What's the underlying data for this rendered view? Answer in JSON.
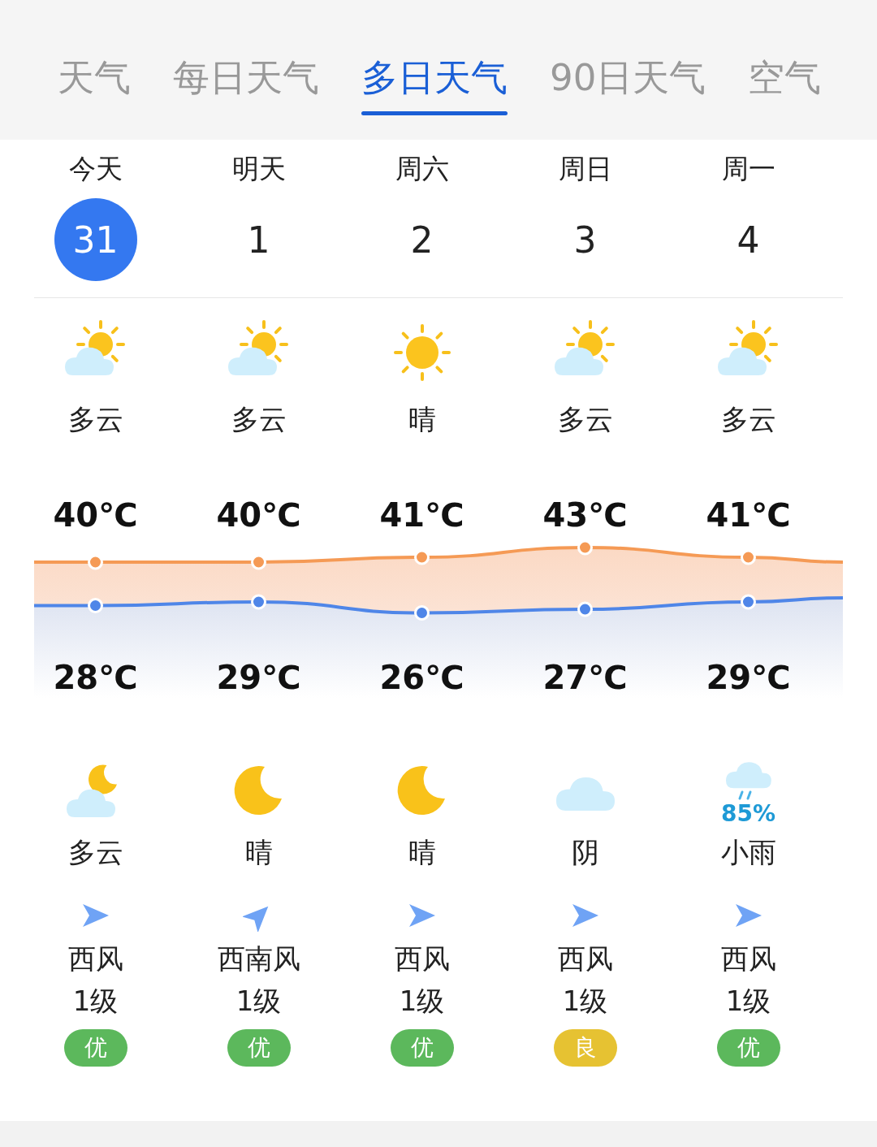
{
  "tabs": [
    {
      "label": "天气",
      "selected": false
    },
    {
      "label": "每日天气",
      "selected": false
    },
    {
      "label": "多日天气",
      "selected": true
    },
    {
      "label": "90日天气",
      "selected": false
    },
    {
      "label": "空气",
      "selected": false
    }
  ],
  "days": [
    {
      "label": "今天",
      "date": "31",
      "selected": true,
      "day": {
        "kind": "partly-cloudy",
        "weather": "多云"
      },
      "high": "40℃",
      "low": "28℃",
      "night": {
        "kind": "moon-cloud",
        "weather": "多云"
      },
      "wind": {
        "kind": "east",
        "direction": "西风",
        "level": "1级"
      },
      "aqi": {
        "label": "优",
        "color": "#5cb85c"
      }
    },
    {
      "label": "明天",
      "date": "1",
      "selected": false,
      "day": {
        "kind": "partly-cloudy",
        "weather": "多云"
      },
      "high": "40℃",
      "low": "29℃",
      "night": {
        "kind": "moon",
        "weather": "晴"
      },
      "wind": {
        "kind": "northeast",
        "direction": "西南风",
        "level": "1级"
      },
      "aqi": {
        "label": "优",
        "color": "#5cb85c"
      }
    },
    {
      "label": "周六",
      "date": "2",
      "selected": false,
      "day": {
        "kind": "sun",
        "weather": "晴"
      },
      "high": "41℃",
      "low": "26℃",
      "night": {
        "kind": "moon",
        "weather": "晴"
      },
      "wind": {
        "kind": "east",
        "direction": "西风",
        "level": "1级"
      },
      "aqi": {
        "label": "优",
        "color": "#5cb85c"
      }
    },
    {
      "label": "周日",
      "date": "3",
      "selected": false,
      "day": {
        "kind": "partly-cloudy",
        "weather": "多云"
      },
      "high": "43℃",
      "low": "27℃",
      "night": {
        "kind": "cloud",
        "weather": "阴"
      },
      "wind": {
        "kind": "east",
        "direction": "西风",
        "level": "1级"
      },
      "aqi": {
        "label": "良",
        "color": "#e6c232"
      }
    },
    {
      "label": "周一",
      "date": "4",
      "selected": false,
      "day": {
        "kind": "partly-cloudy",
        "weather": "多云"
      },
      "high": "41℃",
      "low": "29℃",
      "night": {
        "kind": "rain",
        "precip": "85%",
        "weather": "小雨"
      },
      "wind": {
        "kind": "east",
        "direction": "西风",
        "level": "1级"
      },
      "aqi": {
        "label": "优",
        "color": "#5cb85c"
      }
    }
  ]
}
